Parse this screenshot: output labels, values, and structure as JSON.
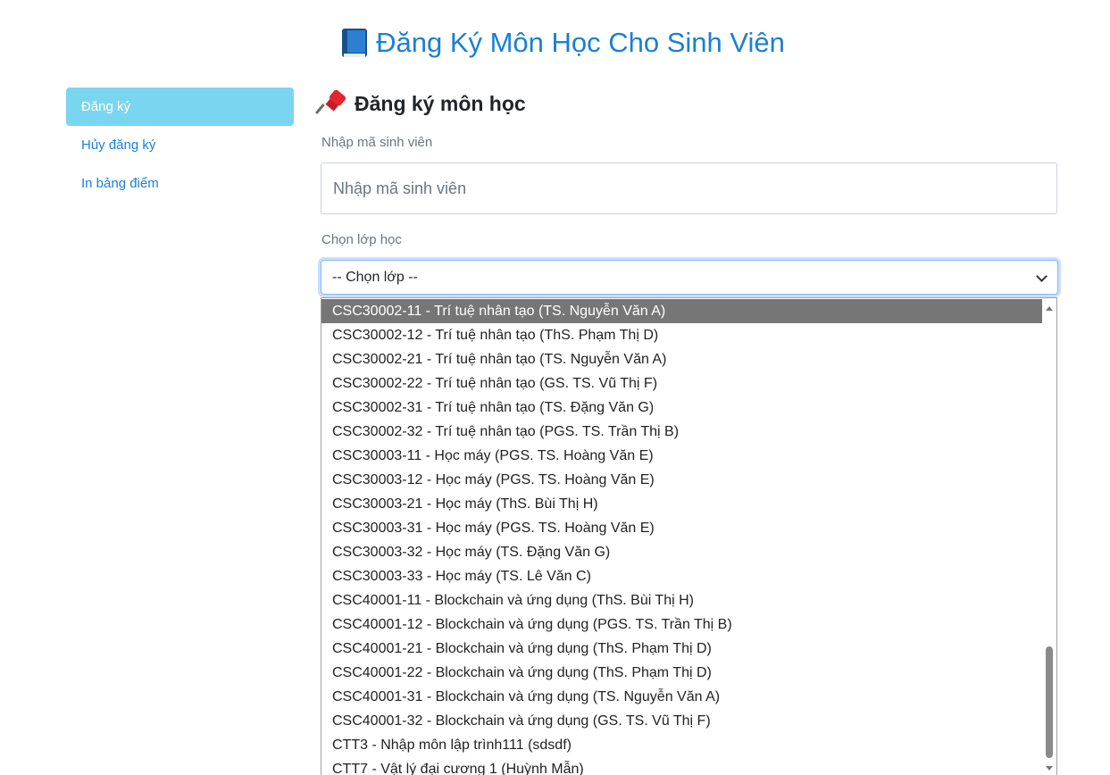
{
  "header": {
    "title": "Đăng Ký Môn Học Cho Sinh Viên",
    "icon": "book-icon"
  },
  "sidebar": {
    "items": [
      {
        "label": "Đăng ký",
        "active": true
      },
      {
        "label": "Hủy đăng ký",
        "active": false
      },
      {
        "label": "In bảng điểm",
        "active": false
      }
    ]
  },
  "main": {
    "section_title": "Đăng ký môn học",
    "section_icon": "pushpin-icon",
    "student_field": {
      "label": "Nhập mã sinh viên",
      "placeholder": "Nhập mã sinh viên",
      "value": ""
    },
    "class_field": {
      "label": "Chọn lớp học",
      "selected": "-- Chọn lớp --"
    }
  },
  "dropdown": {
    "highlighted_index": 0,
    "options": [
      "CSC30002-11 - Trí tuệ nhân tạo (TS. Nguyễn Văn A)",
      "CSC30002-12 - Trí tuệ nhân tạo (ThS. Phạm Thị D)",
      "CSC30002-21 - Trí tuệ nhân tạo (TS. Nguyễn Văn A)",
      "CSC30002-22 - Trí tuệ nhân tạo (GS. TS. Vũ Thị F)",
      "CSC30002-31 - Trí tuệ nhân tạo (TS. Đặng Văn G)",
      "CSC30002-32 - Trí tuệ nhân tạo (PGS. TS. Trần Thị B)",
      "CSC30003-11 - Học máy (PGS. TS. Hoàng Văn E)",
      "CSC30003-12 - Học máy (PGS. TS. Hoàng Văn E)",
      "CSC30003-21 - Học máy (ThS. Bùi Thị H)",
      "CSC30003-31 - Học máy (PGS. TS. Hoàng Văn E)",
      "CSC30003-32 - Học máy (TS. Đặng Văn G)",
      "CSC30003-33 - Học máy (TS. Lê Văn C)",
      "CSC40001-11 - Blockchain và ứng dụng (ThS. Bùi Thị H)",
      "CSC40001-12 - Blockchain và ứng dụng (PGS. TS. Trần Thị B)",
      "CSC40001-21 - Blockchain và ứng dụng (ThS. Phạm Thị D)",
      "CSC40001-22 - Blockchain và ứng dụng (ThS. Phạm Thị D)",
      "CSC40001-31 - Blockchain và ứng dụng (TS. Nguyễn Văn A)",
      "CSC40001-32 - Blockchain và ứng dụng (GS. TS. Vũ Thị F)",
      "CTT3 - Nhập môn lập trình111 (sdsdf)",
      "CTT7 - Vật lý đại cương 1 (Huỳnh Mẫn)"
    ]
  },
  "colors": {
    "accent": "#1a7fd6",
    "sidebar_active": "#7ad6f0",
    "highlight": "#767676"
  }
}
